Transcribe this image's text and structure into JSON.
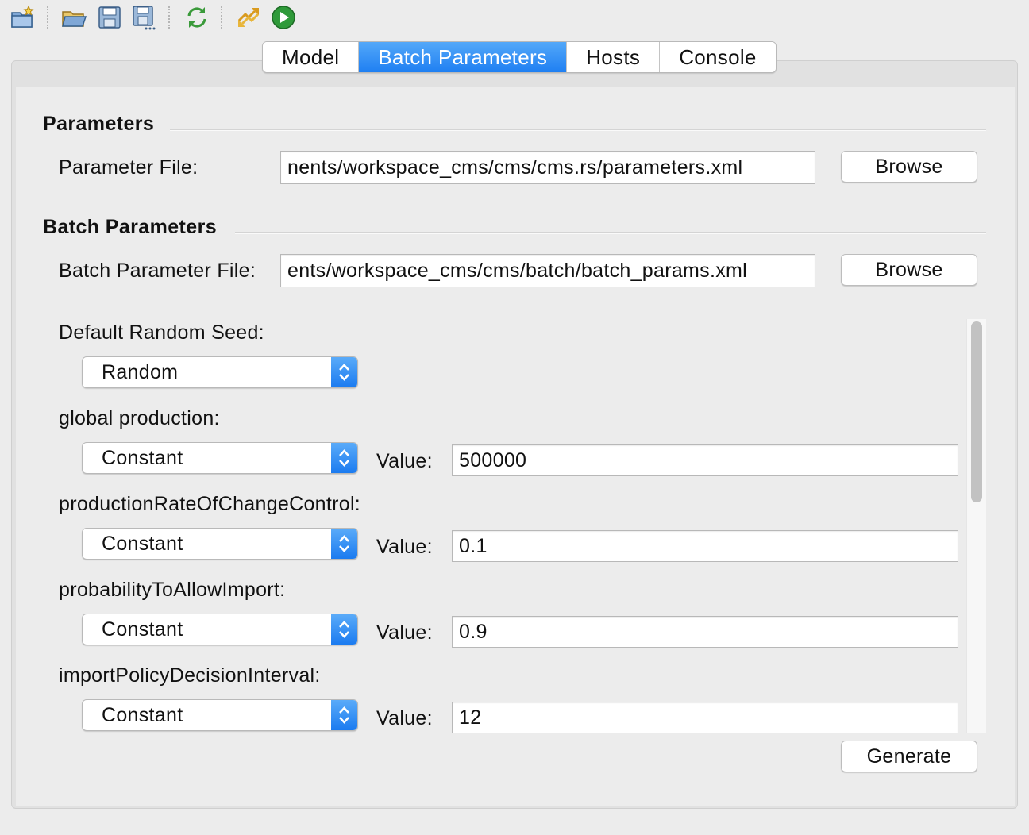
{
  "toolbar": {
    "icons": [
      "new-project-icon",
      "open-folder-icon",
      "save-icon",
      "save-as-icon",
      "refresh-icon",
      "run-batch-icon",
      "play-icon"
    ]
  },
  "tabs": [
    {
      "label": "Model",
      "active": false
    },
    {
      "label": "Batch Parameters",
      "active": true
    },
    {
      "label": "Hosts",
      "active": false
    },
    {
      "label": "Console",
      "active": false
    }
  ],
  "parameters": {
    "section_title": "Parameters",
    "file_label": "Parameter File:",
    "file_value": "nents/workspace_cms/cms/cms.rs/parameters.xml",
    "browse_label": "Browse"
  },
  "batch_parameters": {
    "section_title": "Batch Parameters",
    "file_label": "Batch Parameter File:",
    "file_value": "ents/workspace_cms/cms/batch/batch_params.xml",
    "browse_label": "Browse"
  },
  "seed": {
    "label": "Default Random Seed:",
    "selected": "Random"
  },
  "value_label": "Value:",
  "params": [
    {
      "name": "global production:",
      "type": "Constant",
      "value": "500000"
    },
    {
      "name": "productionRateOfChangeControl:",
      "type": "Constant",
      "value": "0.1"
    },
    {
      "name": "probabilityToAllowImport:",
      "type": "Constant",
      "value": "0.9"
    },
    {
      "name": "importPolicyDecisionInterval:",
      "type": "Constant",
      "value": "12"
    }
  ],
  "generate_label": "Generate",
  "colors": {
    "accent": "#1f7ff2",
    "background": "#ececec",
    "panel": "#e1e1e1"
  }
}
